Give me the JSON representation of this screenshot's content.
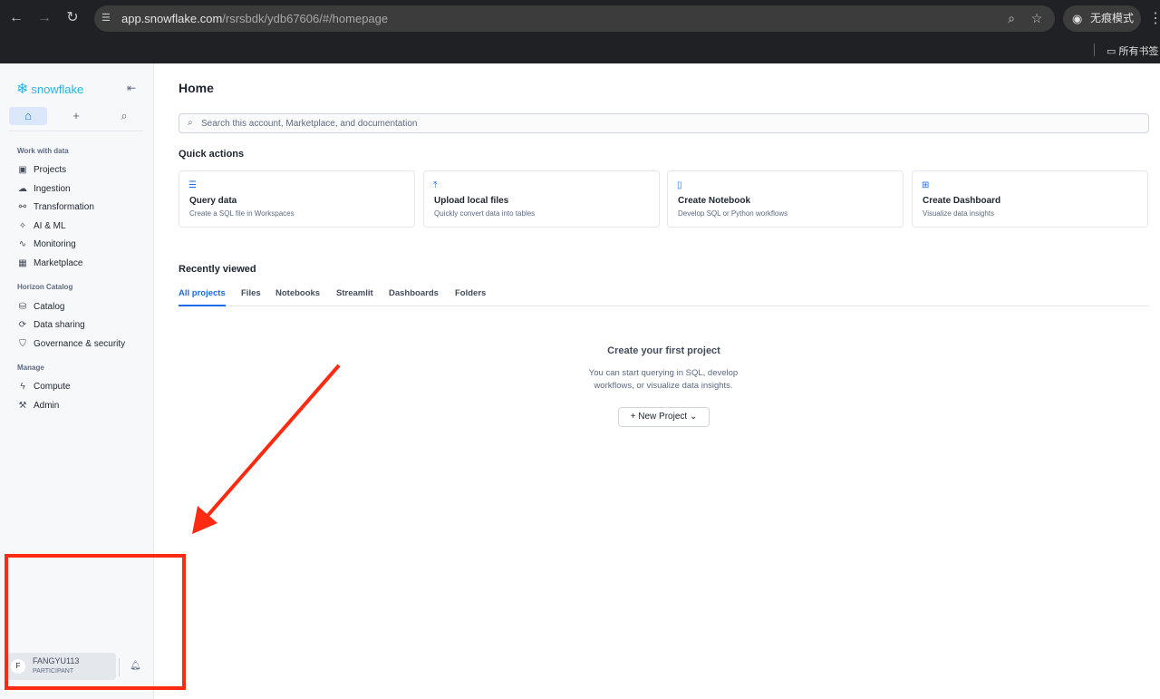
{
  "browser": {
    "url_host": "app.snowflake.com",
    "url_path": "/rsrsbdk/ydb67606/#/homepage",
    "incognito_label": "无痕模式",
    "bookmark_folder": "所有书签"
  },
  "sidebar": {
    "logo_text": "snowflake",
    "sections": [
      {
        "title": "Work with data",
        "items": [
          "Projects",
          "Ingestion",
          "Transformation",
          "AI & ML",
          "Monitoring",
          "Marketplace"
        ]
      },
      {
        "title": "Horizon Catalog",
        "items": [
          "Catalog",
          "Data sharing",
          "Governance & security"
        ]
      },
      {
        "title": "Manage",
        "items": [
          "Compute",
          "Admin"
        ]
      }
    ],
    "user": {
      "initial": "F",
      "name": "FANGYU113",
      "role": "PARTICIPANT"
    }
  },
  "main": {
    "title": "Home",
    "search_placeholder": "Search this account, Marketplace, and documentation",
    "quick_actions_title": "Quick actions",
    "quick_actions": [
      {
        "title": "Query data",
        "subtitle": "Create a SQL file in Workspaces",
        "icon": "query-icon"
      },
      {
        "title": "Upload local files",
        "subtitle": "Quickly convert data into tables",
        "icon": "upload-icon"
      },
      {
        "title": "Create Notebook",
        "subtitle": "Develop SQL or Python workflows",
        "icon": "notebook-icon"
      },
      {
        "title": "Create Dashboard",
        "subtitle": "Visualize data insights",
        "icon": "dashboard-icon"
      }
    ],
    "recent_title": "Recently viewed",
    "tabs": [
      "All projects",
      "Files",
      "Notebooks",
      "Streamlit",
      "Dashboards",
      "Folders"
    ],
    "active_tab": "All projects",
    "empty_title": "Create your first project",
    "empty_subtitle": "You can start querying in SQL, develop workflows, or visualize data insights.",
    "new_project_label": "New Project"
  },
  "annotation": {
    "color": "#ff2a12"
  }
}
